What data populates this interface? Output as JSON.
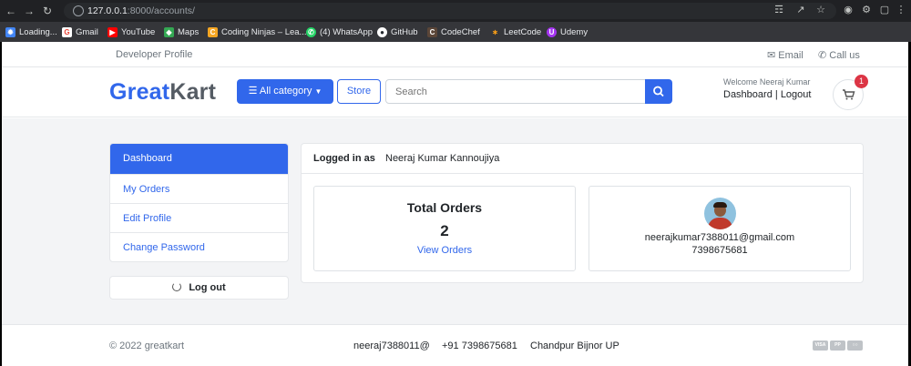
{
  "browser": {
    "url_host": "127.0.0.1",
    "url_path": ":8000/accounts/",
    "bookmarks": [
      {
        "label": "Loading...",
        "icon": "loading-icon",
        "color": "#4285f4"
      },
      {
        "label": "Gmail",
        "icon": "google-icon",
        "color": "#ea4335"
      },
      {
        "label": "YouTube",
        "icon": "youtube-icon",
        "color": "#ff0000"
      },
      {
        "label": "Maps",
        "icon": "maps-icon",
        "color": "#34a853"
      },
      {
        "label": "Coding Ninjas – Lea...",
        "icon": "coding-ninjas-icon",
        "color": "#f5a623"
      },
      {
        "label": "(4) WhatsApp",
        "icon": "whatsapp-icon",
        "color": "#25d366"
      },
      {
        "label": "GitHub",
        "icon": "github-icon",
        "color": "#ffffff"
      },
      {
        "label": "CodeChef",
        "icon": "codechef-icon",
        "color": "#5b4638"
      },
      {
        "label": "LeetCode",
        "icon": "leetcode-icon",
        "color": "#ffa116"
      },
      {
        "label": "Udemy",
        "icon": "udemy-icon",
        "color": "#a435f0"
      }
    ]
  },
  "topbar": {
    "developer": "Developer Profile",
    "email": "Email",
    "call": "Call us"
  },
  "header": {
    "brand_main": "Great",
    "brand_accent": "Kart",
    "category_label": "All category",
    "store_label": "Store",
    "search_placeholder": "Search",
    "welcome": "Welcome Neeraj Kumar",
    "dashboard_link": "Dashboard",
    "separator": "|",
    "logout_link": "Logout",
    "cart_count": "1",
    "brand_color": "#3167eb"
  },
  "sidebar": {
    "items": [
      {
        "label": "Dashboard",
        "active": true
      },
      {
        "label": "My Orders",
        "active": false
      },
      {
        "label": "Edit Profile",
        "active": false
      },
      {
        "label": "Change Password",
        "active": false
      }
    ],
    "logout": "Log out"
  },
  "account": {
    "logged_in_label": "Logged in as",
    "user_name": "Neeraj Kumar Kannoujiya",
    "total_orders_title": "Total Orders",
    "total_orders_count": "2",
    "view_orders": "View Orders",
    "email": "neerajkumar7388011@gmail.com",
    "phone": "7398675681"
  },
  "footer": {
    "copyright": "© 2022 greatkart",
    "email": "neeraj7388011@",
    "phone": "+91 7398675681",
    "address": "Chandpur Bijnor UP",
    "payment_icons": [
      "visa-icon",
      "paypal-icon",
      "mastercard-icon"
    ]
  }
}
